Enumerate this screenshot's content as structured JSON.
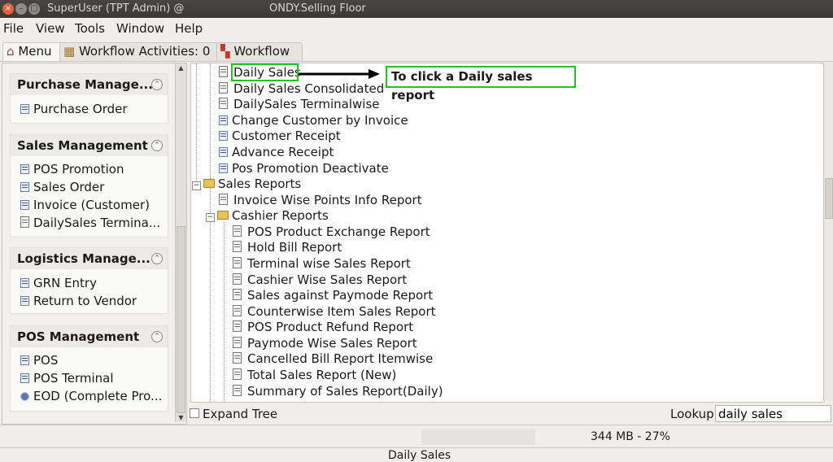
{
  "window": {
    "title_left": "SuperUser (TPT Admin) @",
    "title_right": "ONDY.Selling Floor",
    "close_glyph": "×",
    "min_glyph": "–",
    "max_glyph": "□"
  },
  "menubar": [
    "File",
    "View",
    "Tools",
    "Window",
    "Help"
  ],
  "tabs": {
    "menu": "Menu",
    "workflow_activities": "Workflow Activities: 0",
    "workflow": "Workflow"
  },
  "sidebar": {
    "sections": [
      {
        "title": "Purchase Manage...",
        "items": [
          "Purchase Order"
        ]
      },
      {
        "title": "Sales Management",
        "items": [
          "POS Promotion",
          "Sales Order",
          "Invoice (Customer)",
          "DailySales Termina..."
        ]
      },
      {
        "title": "Logistics Manage...",
        "items": [
          "GRN Entry",
          "Return to Vendor"
        ]
      },
      {
        "title": "POS Management",
        "items": [
          "POS",
          "POS Terminal",
          "EOD (Complete Pro..."
        ]
      }
    ]
  },
  "tree": {
    "items": [
      "Daily Sales",
      "Daily Sales Consolidated",
      "DailySales Terminalwise",
      "Change Customer by Invoice",
      "Customer Receipt",
      "Advance Receipt",
      "Pos Promotion Deactivate",
      "Sales Reports",
      "Invoice Wise Points Info Report",
      "Cashier Reports",
      "POS Product Exchange Report",
      "Hold Bill Report",
      "Terminal wise Sales Report",
      "Cashier Wise Sales Report",
      "Sales against Paymode Report",
      "Counterwise Item Sales Report",
      "POS Product Refund Report",
      "Paymode Wise Sales Report",
      "Cancelled Bill Report Itemwise",
      "Total Sales Report (New)",
      "Summary of Sales Report(Daily)"
    ]
  },
  "annotation": {
    "text": "To click a Daily sales report",
    "color": "#22c322"
  },
  "bottom": {
    "expand_tree": "Expand Tree",
    "lookup_label": "Lookup",
    "lookup_value": "daily sales"
  },
  "status": {
    "memory": "344 MB - 27%",
    "current": "Daily Sales"
  }
}
